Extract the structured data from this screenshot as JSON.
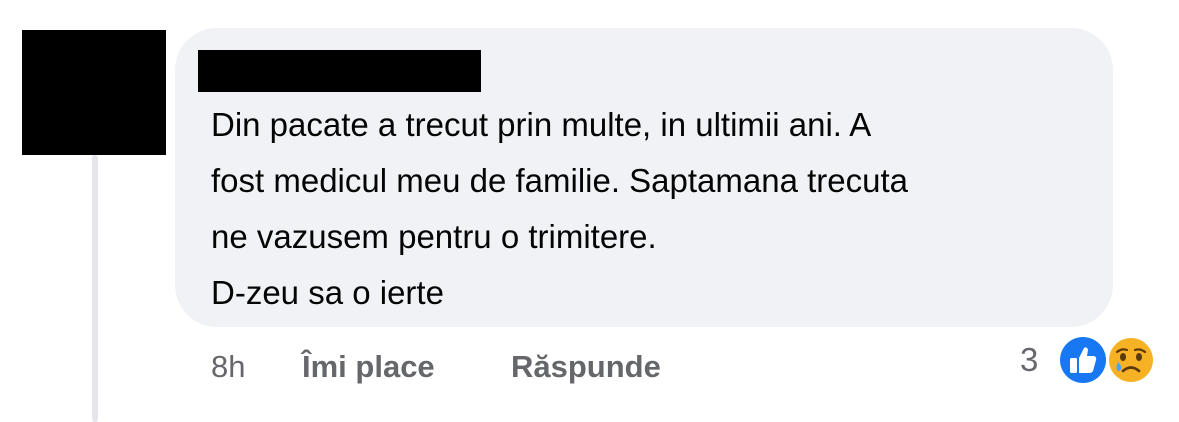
{
  "comment": {
    "lines": [
      "Din pacate a trecut prin multe, in ultimii ani. A",
      "fost medicul meu de familie. Saptamana trecuta",
      "ne vazusem pentru o trimitere.",
      "D-zeu sa o ierte"
    ]
  },
  "actions": {
    "timestamp": "8h",
    "like_label": "Îmi place",
    "reply_label": "Răspunde"
  },
  "reactions": {
    "count": "3",
    "icons": [
      "like-icon",
      "sad-icon"
    ],
    "like_color": "#1877f2",
    "sad_color": "#f7b125"
  },
  "colors": {
    "bubble_bg": "#f0f2f5",
    "text": "#050505",
    "secondary_text": "#65676b",
    "thread_line": "#e4e6eb"
  }
}
